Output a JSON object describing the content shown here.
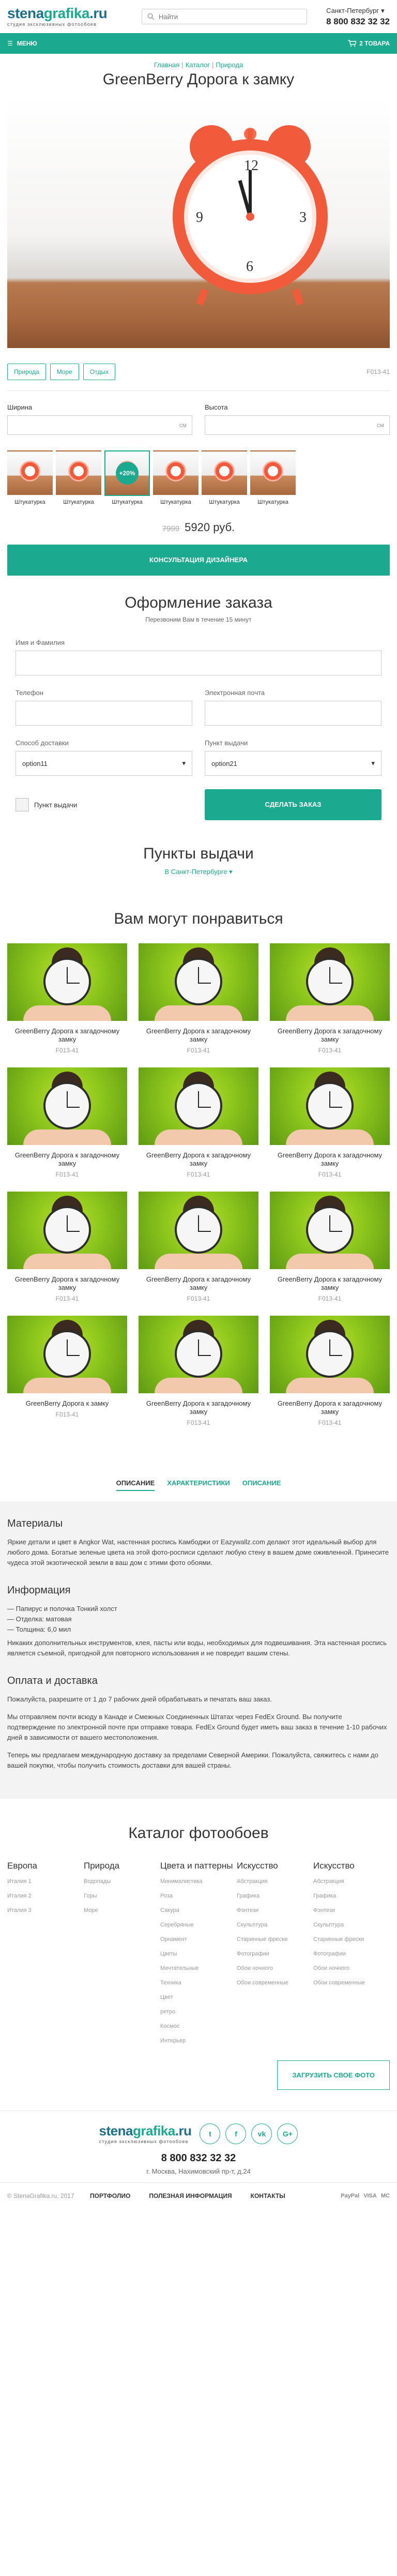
{
  "header": {
    "logo_main": "stena",
    "logo_accent": "grafika",
    "logo_tld": ".ru",
    "logo_sub": "студия эксклюзивных фотообоев",
    "search_placeholder": "Найти",
    "city": "Санкт-Петербург",
    "phone": "8 800 832 32 32"
  },
  "navbar": {
    "menu_label": "МЕНЮ",
    "cart_label": "2 ТОВАРА"
  },
  "breadcrumb": [
    "Главная",
    "Каталог",
    "Природа"
  ],
  "page_title": "GreenBerry Дорога к замку",
  "tags": [
    "Природа",
    "Море",
    "Отдых"
  ],
  "sku": "F013-41",
  "dimensions": {
    "width_label": "Ширина",
    "height_label": "Высота",
    "unit": "см"
  },
  "textures": [
    {
      "label": "Штукатурка",
      "badge": ""
    },
    {
      "label": "Штукатурка",
      "badge": ""
    },
    {
      "label": "Штукатурка",
      "badge": "+20%"
    },
    {
      "label": "Штукатурка",
      "badge": ""
    },
    {
      "label": "Штукатурка",
      "badge": ""
    },
    {
      "label": "Штукатурка",
      "badge": ""
    }
  ],
  "price": {
    "old": "7999",
    "current": "5920 руб."
  },
  "consult_button": "КОНСУЛЬТАЦИЯ ДИЗАЙНЕРА",
  "order": {
    "title": "Оформление заказа",
    "subtitle": "Перезвоним Вам в течение 15 минут",
    "name_label": "Имя и Фамилия",
    "phone_label": "Телефон",
    "email_label": "Электронная почта",
    "delivery_label": "Способ доставки",
    "delivery_value": "option11",
    "pickup_point_label": "Пункт выдачи",
    "pickup_point_value": "option21",
    "pickup_checkbox_label": "Пункт выдачи",
    "submit": "СДЕЛАТЬ ЗАКАЗ"
  },
  "points": {
    "title": "Пункты выдачи",
    "city": "В Санкт-Петербурге"
  },
  "may_like_title": "Вам могут понравиться",
  "products": [
    {
      "name": "GreenBerry Дорога к загадочному замку",
      "code": "F013-41"
    },
    {
      "name": "GreenBerry Дорога к загадочному замку",
      "code": "F013-41"
    },
    {
      "name": "GreenBerry Дорога к загадочному замку",
      "code": "F013-41"
    },
    {
      "name": "GreenBerry Дорога к загадочному замку",
      "code": "F013-41"
    },
    {
      "name": "GreenBerry Дорога к загадочному замку",
      "code": "F013-41"
    },
    {
      "name": "GreenBerry Дорога к загадочному замку",
      "code": "F013-41"
    },
    {
      "name": "GreenBerry Дорога к загадочному замку",
      "code": "F013-41"
    },
    {
      "name": "GreenBerry Дорога к загадочному замку",
      "code": "F013-41"
    },
    {
      "name": "GreenBerry Дорога к загадочному замку",
      "code": "F013-41"
    },
    {
      "name": "GreenBerry Дорога к замку",
      "code": "F013-41"
    },
    {
      "name": "GreenBerry Дорога к загадочному замку",
      "code": "F013-41"
    },
    {
      "name": "GreenBerry Дорога к загадочному замку",
      "code": "F013-41"
    }
  ],
  "tabs": [
    "ОПИСАНИЕ",
    "ХАРАКТЕРИСТИКИ",
    "ОПИСАНИЕ"
  ],
  "description": {
    "materials_title": "Материалы",
    "materials_text": "Яркие детали и цвет в Angkor Wat, настенная роспись Камбоджи от Eazywallz.com делают этот идеальный выбор для любого дома. Богатые зеленые цвета на этой фото-росписи сделают любую стену в вашем доме оживленной. Принесите чудеса этой экзотической земли в ваш дом с этими фото обоями.",
    "info_title": "Информация",
    "info_items": [
      "— Папирус и полочка Тонкий холст",
      "— Отделка: матовая",
      "— Толщина: 6,0 мил"
    ],
    "info_text": "Никаких дополнительных инструментов, клея, пасты или воды, необходимых для подвешивания. Эта настенная роспись является съемной, пригодной для повторного использования и не повредит вашим стены.",
    "pay_title": "Оплата и доставка",
    "pay_text_1": "Пожалуйста, разрешите от 1 до 7 рабочих дней обрабатывать и печатать ваш заказ.",
    "pay_text_2": "Мы отправляем почти всюду в Канаде и Смежных Соединенных Штатах через FedEx Ground. Вы получите подтверждение по электронной почте при отправке товара. FedEx Ground будет иметь ваш заказ в течение 1-10 рабочих дней в зависимости от вашего местоположения.",
    "pay_text_3": "Теперь мы предлагаем международную доставку за пределами Северной Америки. Пожалуйста, свяжитесь с нами до вашей покупки, чтобы получить стоимость доставки для вашей страны."
  },
  "catalog": {
    "title": "Каталог фотообоев",
    "columns": [
      {
        "title": "Европа",
        "items": [
          "Италия 1",
          "Италия 2",
          "Италия 3"
        ]
      },
      {
        "title": "Природа",
        "items": [
          "Водопады",
          "Горы",
          "Море"
        ]
      },
      {
        "title": "Цвета и паттерны",
        "items": [
          "Минималистика",
          "Роза",
          "Сакура",
          "Серебряные",
          "Орнамент",
          "Цветы",
          "Мечтательные",
          "Техника",
          "Цвет",
          "ретро",
          "Космос",
          "Интерьер"
        ]
      },
      {
        "title": "Искусство",
        "items": [
          "Абстракция",
          "Графика",
          "Фэнтези",
          "Скульптура",
          "Старинные фрески",
          "Фотографии",
          "Обои ночного",
          "Обои современные"
        ]
      },
      {
        "title": "Искусство",
        "items": [
          "Абстракция",
          "Графика",
          "Фэнтези",
          "Скульптура",
          "Старинные фрески",
          "Фотографии",
          "Обои ночного",
          "Обои современные"
        ]
      }
    ],
    "upload_button": "ЗАГРУЗИТЬ СВОЕ ФОТО"
  },
  "footer": {
    "social": [
      "t",
      "f",
      "vk",
      "G+"
    ],
    "phone": "8 800 832 32 32",
    "address": "г. Москва, Нахимовский пр-т, д.24",
    "copyright": "© StenaGrafika.ru, 2017",
    "links": [
      "ПОРТФОЛИО",
      "ПОЛЕЗНАЯ ИНФОРМАЦИЯ",
      "КОНТАКТЫ"
    ],
    "payments": [
      "PayPal",
      "VISA",
      "MC"
    ]
  },
  "colors": {
    "accent": "#1ba98f",
    "brand": "#1e6f8c"
  }
}
